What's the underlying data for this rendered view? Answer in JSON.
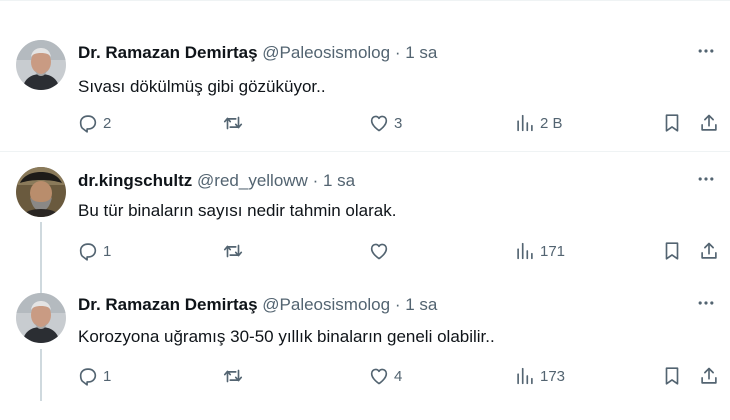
{
  "tweets": [
    {
      "name": "Dr. Ramazan Demirtaş",
      "handle": "@Paleosismolog",
      "separator": "·",
      "time": "1 sa",
      "text": "Sıvası dökülmüş gibi gözüküyor..",
      "replies": "2",
      "retweets": "",
      "likes": "3",
      "views": "2 B"
    },
    {
      "name": "dr.kingschultz",
      "handle": "@red_yelloww",
      "separator": "·",
      "time": "1 sa",
      "text": "Bu tür binaların sayısı nedir tahmin olarak.",
      "replies": "1",
      "retweets": "",
      "likes": "",
      "views": "171"
    },
    {
      "name": "Dr. Ramazan Demirtaş",
      "handle": "@Paleosismolog",
      "separator": "·",
      "time": "1 sa",
      "text": "Korozyona uğramış 30-50 yıllık binaların geneli olabilir..",
      "replies": "1",
      "retweets": "",
      "likes": "4",
      "views": "173"
    }
  ],
  "icons": {
    "reply": "reply-icon",
    "retweet": "retweet-icon",
    "like": "heart-icon",
    "views": "views-icon",
    "bookmark": "bookmark-icon",
    "share": "share-icon",
    "more": "more-icon"
  },
  "colors": {
    "secondary_text": "#536471",
    "thread_line": "#cfd9de",
    "separator": "#eff3f4"
  }
}
